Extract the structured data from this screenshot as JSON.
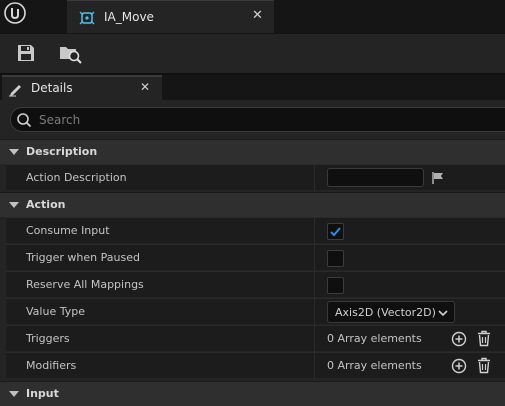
{
  "asset_tab": {
    "title": "IA_Move",
    "close_glyph": "✕"
  },
  "toolbar": {
    "icons": [
      "save-icon",
      "browse-asset-icon"
    ]
  },
  "details_tab": {
    "title": "Details",
    "close_glyph": "✕"
  },
  "search": {
    "placeholder": "Search",
    "value": ""
  },
  "categories": {
    "description": "Description",
    "action": "Action",
    "input": "Input"
  },
  "properties": {
    "action_description": {
      "label": "Action Description",
      "value": ""
    },
    "consume_input": {
      "label": "Consume Input",
      "checked": true
    },
    "trigger_when_paused": {
      "label": "Trigger when Paused",
      "checked": false
    },
    "reserve_all_mappings": {
      "label": "Reserve All Mappings",
      "checked": false
    },
    "value_type": {
      "label": "Value Type",
      "selected": "Axis2D (Vector2D)"
    },
    "triggers": {
      "label": "Triggers",
      "value": "0 Array elements"
    },
    "modifiers": {
      "label": "Modifiers",
      "value": "0 Array elements"
    }
  },
  "colors": {
    "accent": "#2d8ceb",
    "panel": "#242424",
    "row": "#1c1c1c",
    "category": "#2f2f2f"
  }
}
